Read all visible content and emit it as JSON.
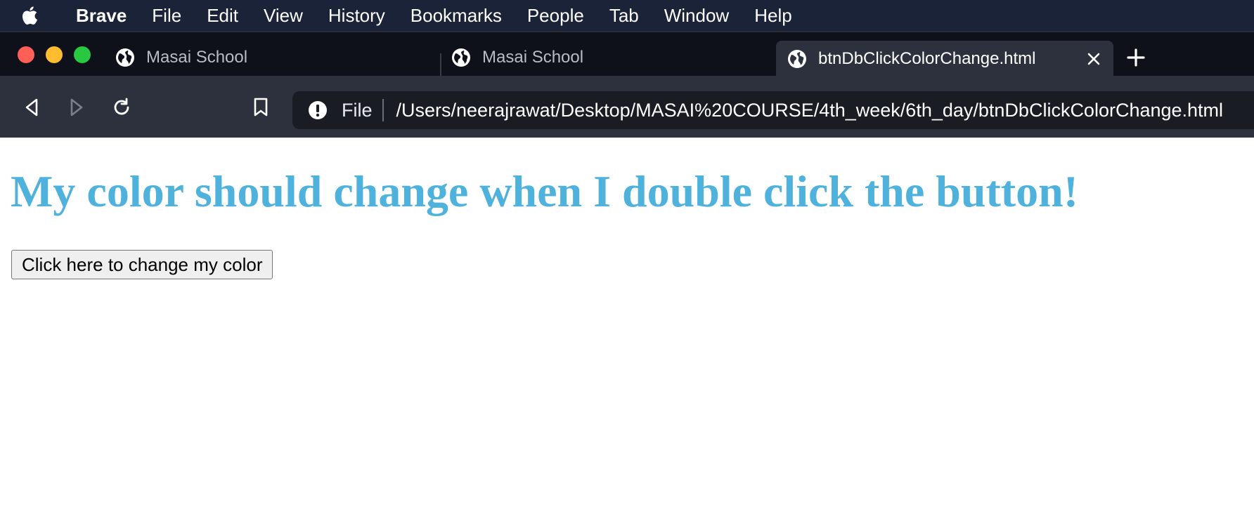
{
  "menubar": {
    "app_name": "Brave",
    "items": [
      "File",
      "Edit",
      "View",
      "History",
      "Bookmarks",
      "People",
      "Tab",
      "Window",
      "Help"
    ]
  },
  "tabs": [
    {
      "title": "Masai School",
      "active": false,
      "icon": "globe-icon"
    },
    {
      "title": "Masai School",
      "active": false,
      "icon": "globe-icon"
    },
    {
      "title": "btnDbClickColorChange.html",
      "active": true,
      "icon": "globe-icon"
    }
  ],
  "omnibox": {
    "scheme_label": "File",
    "url": "/Users/neerajrawat/Desktop/MASAI%20COURSE/4th_week/6th_day/btnDbClickColorChange.html"
  },
  "page": {
    "heading": "My color should change when I double click the button!",
    "heading_color": "#4eb2dd",
    "button_label": "Click here to change my color"
  },
  "colors": {
    "menubar_bg": "#1b2338",
    "tabbar_bg": "#0f111a",
    "toolbar_bg": "#2d313d"
  }
}
